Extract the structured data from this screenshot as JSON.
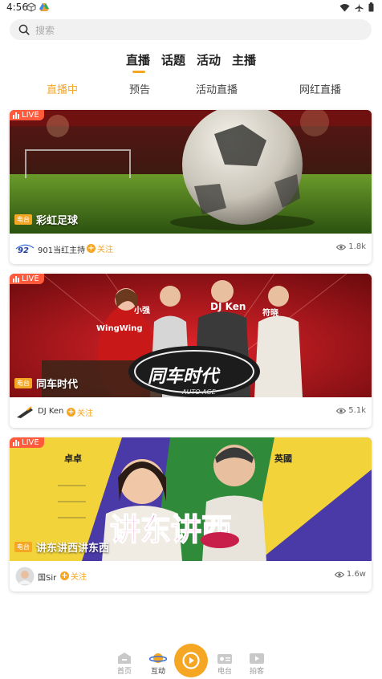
{
  "status_bar": {
    "time": "4:56"
  },
  "search": {
    "placeholder": "搜索"
  },
  "main_tabs": [
    {
      "label": "直播",
      "active": true
    },
    {
      "label": "话题"
    },
    {
      "label": "活动"
    },
    {
      "label": "主播"
    }
  ],
  "sub_tabs": [
    {
      "label": "直播中",
      "active": true
    },
    {
      "label": "预告"
    },
    {
      "label": "活动直播"
    },
    {
      "label": "网红直播"
    }
  ],
  "cards": [
    {
      "live": "LIVE",
      "tag": "电台",
      "title": "彩虹足球",
      "host": "901当红主持",
      "logo_text": "92",
      "follow": "关注",
      "views": "1.8k"
    },
    {
      "live": "LIVE",
      "tag": "电台",
      "title": "同车时代",
      "host": "DJ Ken",
      "follow": "关注",
      "views": "5.1k",
      "image_texts": {
        "n1": "WingWing",
        "n2": "小强",
        "n3": "DJ Ken",
        "n4": "符晓",
        "logo_main": "同车时代",
        "logo_sub": "AUTO AGE"
      }
    },
    {
      "live": "LIVE",
      "tag": "电台",
      "title": "讲东讲西讲东西",
      "host": "国Sir",
      "follow": "关注",
      "views": "1.6w",
      "image_texts": {
        "n1": "卓卓",
        "n2": "英國",
        "big": "讲东讲西"
      }
    }
  ],
  "bottom_nav": [
    {
      "label": "首页",
      "icon": "home-icon"
    },
    {
      "label": "互动",
      "icon": "planet-icon",
      "active": true
    },
    {
      "label": "",
      "icon": "play-icon"
    },
    {
      "label": "电台",
      "icon": "radio-icon"
    },
    {
      "label": "拍客",
      "icon": "video-camera-icon"
    }
  ],
  "colors": {
    "accent": "#f5a623",
    "live": "#ff5a3c"
  }
}
